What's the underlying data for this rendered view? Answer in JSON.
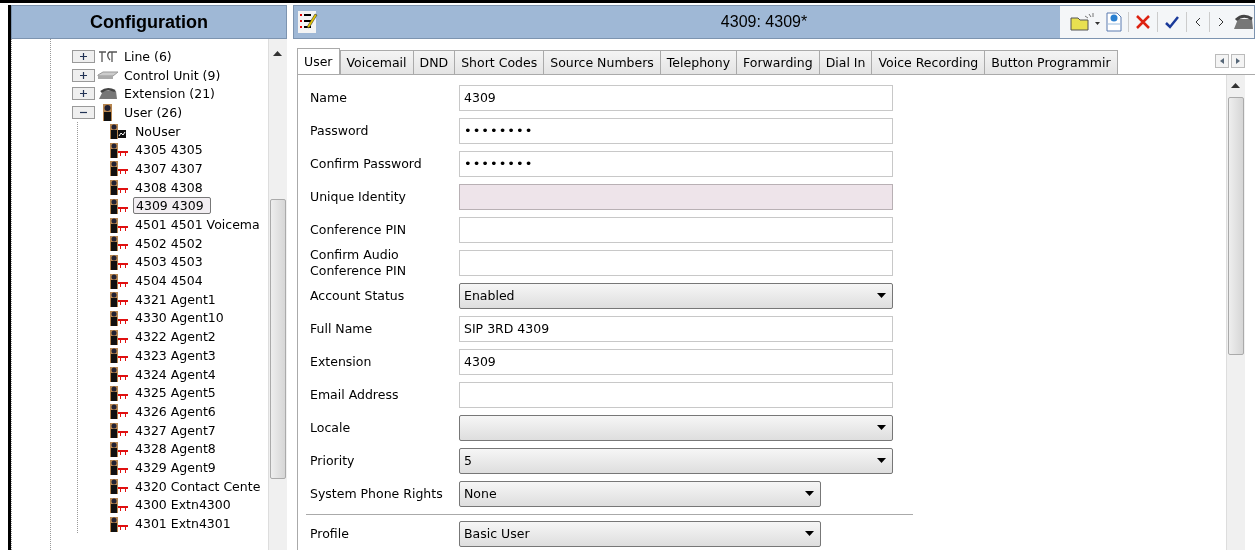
{
  "config_panel": {
    "title": "Configuration",
    "tree": [
      {
        "label": "Line (6)",
        "kind": "line",
        "expanded": false
      },
      {
        "label": "Control Unit (9)",
        "kind": "control-unit",
        "expanded": false
      },
      {
        "label": "Extension (21)",
        "kind": "extension",
        "expanded": false
      },
      {
        "label": "User (26)",
        "kind": "user-group",
        "expanded": true,
        "children": [
          {
            "label": "NoUser",
            "kind": "nouser",
            "selected": false
          },
          {
            "label": "4305 4305",
            "kind": "user",
            "selected": false
          },
          {
            "label": "4307 4307",
            "kind": "user",
            "selected": false
          },
          {
            "label": "4308 4308",
            "kind": "user",
            "selected": false
          },
          {
            "label": "4309 4309",
            "kind": "user",
            "selected": true
          },
          {
            "label": "4501 4501 Voicema",
            "kind": "user",
            "selected": false
          },
          {
            "label": "4502 4502",
            "kind": "user",
            "selected": false
          },
          {
            "label": "4503 4503",
            "kind": "user",
            "selected": false
          },
          {
            "label": "4504 4504",
            "kind": "user",
            "selected": false
          },
          {
            "label": "4321 Agent1",
            "kind": "user",
            "selected": false
          },
          {
            "label": "4330 Agent10",
            "kind": "user",
            "selected": false
          },
          {
            "label": "4322 Agent2",
            "kind": "user",
            "selected": false
          },
          {
            "label": "4323 Agent3",
            "kind": "user",
            "selected": false
          },
          {
            "label": "4324 Agent4",
            "kind": "user",
            "selected": false
          },
          {
            "label": "4325 Agent5",
            "kind": "user",
            "selected": false
          },
          {
            "label": "4326 Agent6",
            "kind": "user",
            "selected": false
          },
          {
            "label": "4327 Agent7",
            "kind": "user",
            "selected": false
          },
          {
            "label": "4328 Agent8",
            "kind": "user",
            "selected": false
          },
          {
            "label": "4329 Agent9",
            "kind": "user",
            "selected": false
          },
          {
            "label": "4320 Contact Cente",
            "kind": "user",
            "selected": false
          },
          {
            "label": "4300 Extn4300",
            "kind": "user",
            "selected": false
          },
          {
            "label": "4301 Extn4301",
            "kind": "user",
            "selected": false
          }
        ]
      }
    ]
  },
  "detail_panel": {
    "title": "4309: 4309*",
    "tabs": [
      {
        "label": "User",
        "selected": true
      },
      {
        "label": "Voicemail",
        "selected": false
      },
      {
        "label": "DND",
        "selected": false
      },
      {
        "label": "Short Codes",
        "selected": false
      },
      {
        "label": "Source Numbers",
        "selected": false
      },
      {
        "label": "Telephony",
        "selected": false
      },
      {
        "label": "Forwarding",
        "selected": false
      },
      {
        "label": "Dial In",
        "selected": false
      },
      {
        "label": "Voice Recording",
        "selected": false
      },
      {
        "label": "Button Programmir",
        "selected": false
      }
    ],
    "fields": [
      {
        "label": "Name",
        "kind": "text",
        "value": "4309",
        "disabled": false
      },
      {
        "label": "Password",
        "kind": "password",
        "value": "••••••••",
        "disabled": false
      },
      {
        "label": "Confirm Password",
        "kind": "password",
        "value": "••••••••",
        "disabled": false
      },
      {
        "label": "Unique Identity",
        "kind": "text",
        "disabled": true
      },
      {
        "label": "Conference PIN",
        "kind": "text",
        "disabled": false
      },
      {
        "label": "Confirm Audio Conference PIN",
        "kind": "text",
        "disabled": false
      },
      {
        "label": "Account Status",
        "kind": "select",
        "value": "Enabled",
        "disabled": false
      },
      {
        "label": "Full Name",
        "kind": "text",
        "value": "SIP 3RD 4309",
        "disabled": false
      },
      {
        "label": "Extension",
        "kind": "text",
        "value": "4309",
        "disabled": false
      },
      {
        "label": "Email Address",
        "kind": "text",
        "disabled": false
      },
      {
        "label": "Locale",
        "kind": "select",
        "disabled": false
      },
      {
        "label": "Priority",
        "kind": "select",
        "value": "5",
        "disabled": false
      },
      {
        "label": "System Phone Rights",
        "kind": "select-short",
        "value": "None",
        "disabled": false
      },
      {
        "label": "Profile",
        "kind": "select-short",
        "value": "Basic User",
        "disabled": false,
        "separated": true
      }
    ]
  }
}
